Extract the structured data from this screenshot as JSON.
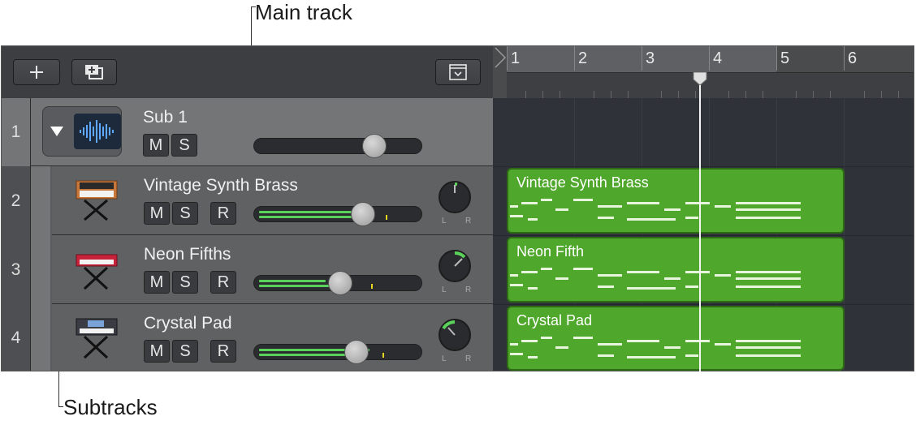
{
  "callouts": {
    "main_track": "Main track",
    "subtracks": "Subtracks"
  },
  "ruler": {
    "bars": [
      "1",
      "2",
      "3",
      "4",
      "5",
      "6"
    ]
  },
  "main_track": {
    "number": "1",
    "name": "Sub 1",
    "mute": "M",
    "solo": "S",
    "volume_fraction": 0.72
  },
  "subtracks": [
    {
      "number": "2",
      "name": "Vintage Synth Brass",
      "mute": "M",
      "solo": "S",
      "record": "R",
      "volume_fraction": 0.65,
      "region": "Vintage Synth Brass"
    },
    {
      "number": "3",
      "name": "Neon Fifths",
      "mute": "M",
      "solo": "S",
      "record": "R",
      "volume_fraction": 0.51,
      "region": "Neon Fifth"
    },
    {
      "number": "4",
      "name": "Crystal Pad",
      "mute": "M",
      "solo": "S",
      "record": "R",
      "volume_fraction": 0.6,
      "region": "Crystal Pad"
    }
  ],
  "knob_labels": {
    "left": "L",
    "right": "R"
  },
  "icons": {
    "add": "plus-icon",
    "duplicate": "duplicate-track-icon",
    "collapse": "dropdown-box-icon",
    "disclosure": "disclosure-triangle-icon",
    "waveform": "waveform-icon",
    "instruments": [
      "analog-synth-icon",
      "red-keyboard-icon",
      "workstation-keyboard-icon"
    ]
  },
  "colors": {
    "region": "#4fa72b",
    "meter": "#5ad15a",
    "peak": "#e6d520"
  }
}
